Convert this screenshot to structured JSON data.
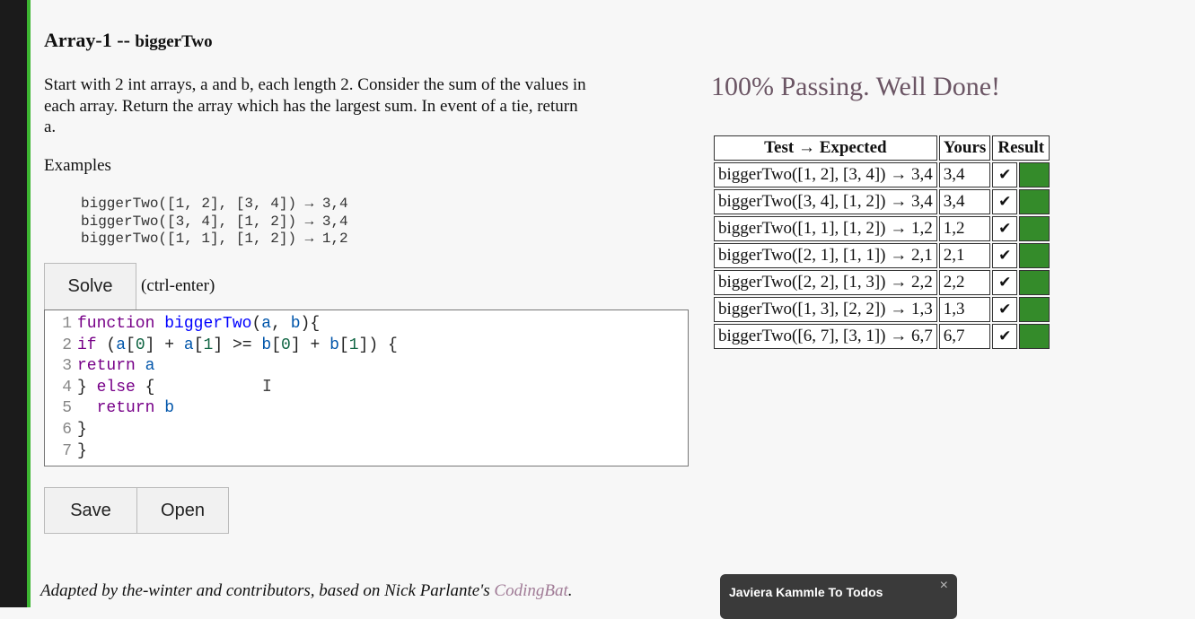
{
  "problem": {
    "title_main": "Array-1 -- ",
    "title_name": "biggerTwo",
    "description": "Start with 2 int arrays, a and b, each length 2. Consider the sum of the values in each array. Return the array which has the largest sum. In event of a tie, return a.",
    "examples_label": "Examples",
    "examples": [
      "biggerTwo([1, 2], [3, 4]) → 3,4",
      "biggerTwo([3, 4], [1, 2]) → 3,4",
      "biggerTwo([1, 1], [1, 2]) → 1,2"
    ]
  },
  "controls": {
    "solve_label": "Solve",
    "ctrl_hint": "(ctrl-enter)",
    "save_label": "Save",
    "open_label": "Open"
  },
  "editor": {
    "line_numbers": [
      "1",
      "2",
      "3",
      "4",
      "5",
      "6",
      "7"
    ],
    "lines": [
      "function biggerTwo(a, b){",
      "if (a[0] + a[1] >= b[0] + b[1]) {",
      "return a",
      "} else {",
      "  return b",
      "}",
      "}"
    ]
  },
  "results": {
    "status": "100% Passing. Well Done!",
    "headers": [
      "Test → Expected",
      "Yours",
      "Result"
    ],
    "rows": [
      {
        "test": "biggerTwo([1, 2], [3, 4]) → 3,4",
        "yours": "3,4",
        "check": "✔"
      },
      {
        "test": "biggerTwo([3, 4], [1, 2]) → 3,4",
        "yours": "3,4",
        "check": "✔"
      },
      {
        "test": "biggerTwo([1, 1], [1, 2]) → 1,2",
        "yours": "1,2",
        "check": "✔"
      },
      {
        "test": "biggerTwo([2, 1], [1, 1]) → 2,1",
        "yours": "2,1",
        "check": "✔"
      },
      {
        "test": "biggerTwo([2, 2], [1, 3]) → 2,2",
        "yours": "2,2",
        "check": "✔"
      },
      {
        "test": "biggerTwo([1, 3], [2, 2]) → 1,3",
        "yours": "1,3",
        "check": "✔"
      },
      {
        "test": "biggerTwo([6, 7], [3, 1]) → 6,7",
        "yours": "6,7",
        "check": "✔"
      }
    ],
    "pass_color": "#348b2a"
  },
  "footer": {
    "text": "Adapted by the-winter and contributors, based on Nick Parlante's ",
    "link": "CodingBat",
    "end": "."
  },
  "chat": {
    "name": "Javiera Kammle To Todos",
    "close_icon": "×"
  }
}
